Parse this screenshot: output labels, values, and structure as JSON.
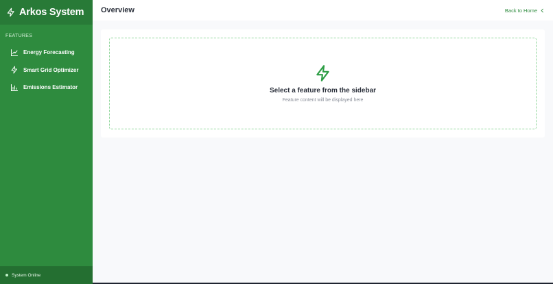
{
  "brand": {
    "title": "Arkos System",
    "icon": "lightning-icon"
  },
  "sidebar": {
    "section_label": "FEATURES",
    "items": [
      {
        "label": "Energy Forecasting",
        "icon": "line-chart-icon"
      },
      {
        "label": "Smart Grid Optimizer",
        "icon": "lightning-icon"
      },
      {
        "label": "Emissions Estimator",
        "icon": "bar-chart-icon"
      }
    ],
    "status": "System Online"
  },
  "header": {
    "title": "Overview",
    "back_label": "Back to Home"
  },
  "empty_state": {
    "title": "Select a feature from the sidebar",
    "subtitle": "Feature content will be displayed here"
  },
  "colors": {
    "sidebar": "#2e8b3e",
    "accent": "#2e8b3e",
    "dashed_border": "#8fd69a"
  }
}
